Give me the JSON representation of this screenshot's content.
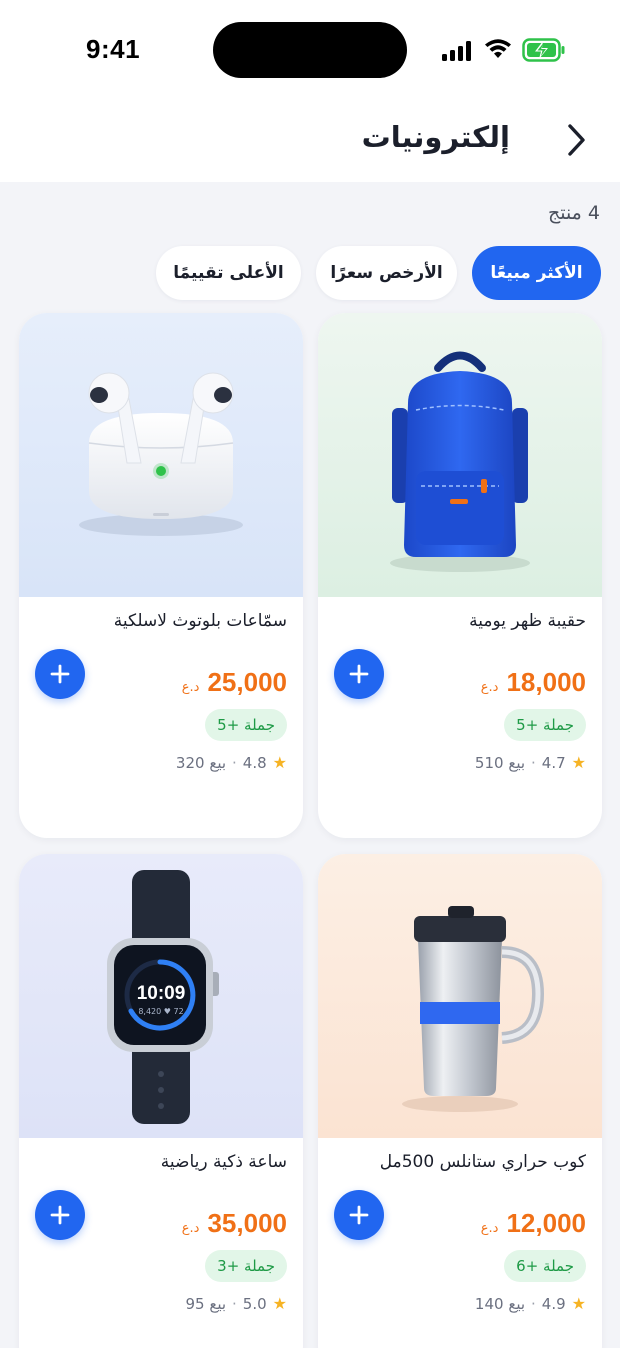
{
  "status": {
    "time": "9:41"
  },
  "header": {
    "title": "إلكترونيات"
  },
  "count_label": "4 منتج",
  "filters": [
    {
      "label": "الأكثر مبيعًا",
      "active": true
    },
    {
      "label": "الأرخص سعرًا",
      "active": false
    },
    {
      "label": "الأعلى تقييمًا",
      "active": false
    }
  ],
  "products": [
    {
      "name": "حقيبة ظهر يومية",
      "price": "18,000",
      "currency": "د.ع",
      "bulk": "جملة +5",
      "rating": "4.7",
      "sold": "بيع 510",
      "image": "backpack"
    },
    {
      "name": "سمّاعات بلوتوث لاسلكية",
      "price": "25,000",
      "currency": "د.ع",
      "bulk": "جملة +5",
      "rating": "4.8",
      "sold": "بيع 320",
      "image": "earbuds"
    },
    {
      "name": "كوب حراري ستانلس 500مل",
      "price": "12,000",
      "currency": "د.ع",
      "bulk": "جملة +6",
      "rating": "4.9",
      "sold": "بيع 140",
      "image": "thermal-mug"
    },
    {
      "name": "ساعة ذكية رياضية",
      "price": "35,000",
      "currency": "د.ع",
      "bulk": "جملة +3",
      "rating": "5.0",
      "sold": "بيع 95",
      "image": "smartwatch"
    }
  ],
  "watch_face": {
    "time": "10:09",
    "steps": "8,420 ♥ 72"
  },
  "colors": {
    "accent": "#2166f0",
    "price": "#f07016",
    "bulk_bg": "#e2f6e8",
    "bulk_text": "#1e9a46",
    "star": "#f6b324"
  }
}
